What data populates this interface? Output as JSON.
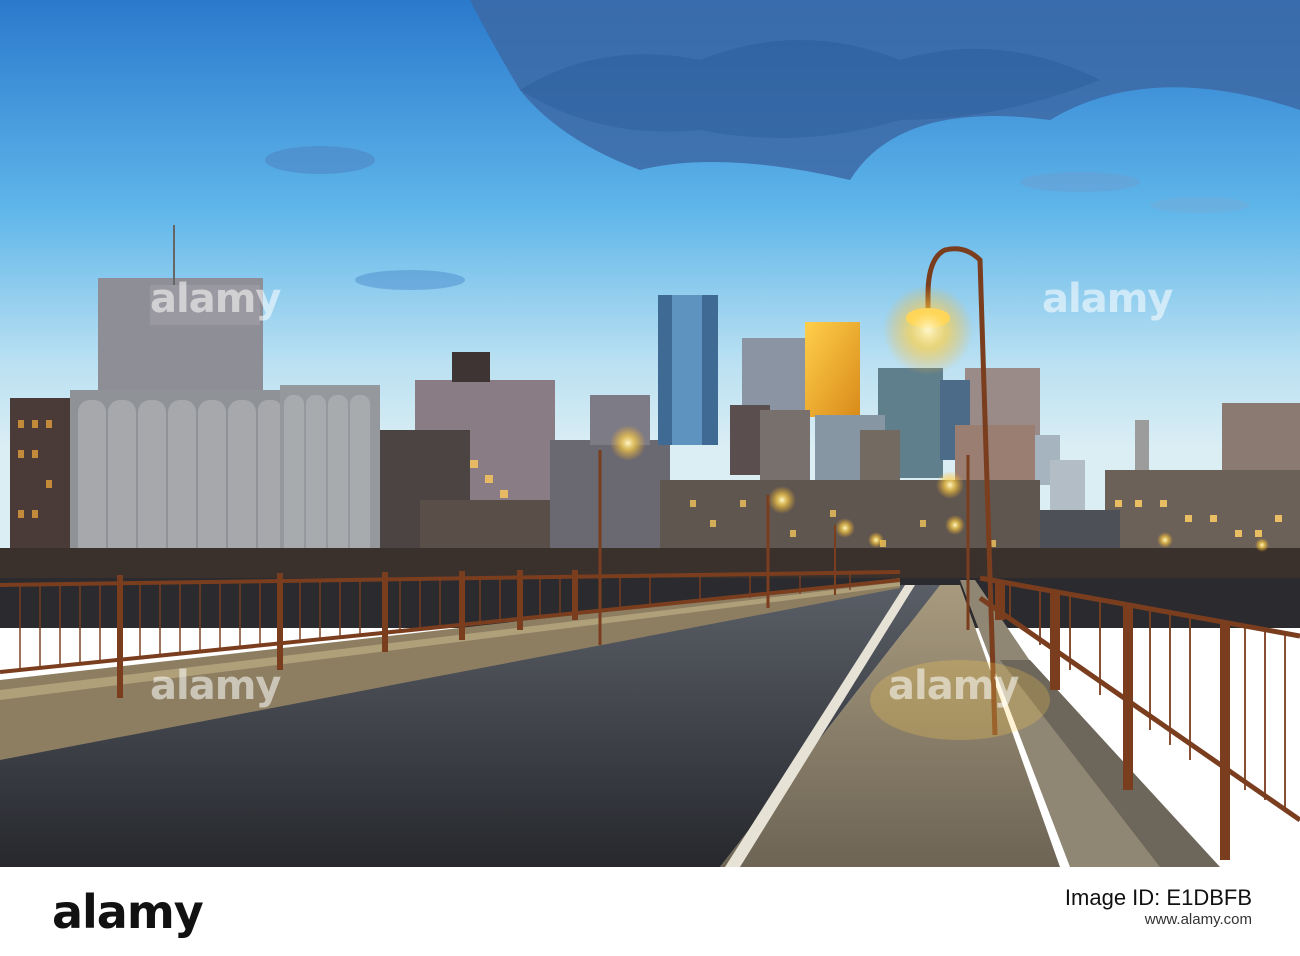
{
  "watermark": {
    "text": "alamy",
    "instances": [
      "alamy",
      "alamy",
      "alamy",
      "alamy"
    ]
  },
  "footer": {
    "logo": "alamy",
    "image_id_label": "Image ID: E1DBFB",
    "website": "www.alamy.com"
  },
  "colors": {
    "sky_top": "#2f7fd0",
    "sky_bottom": "#cfe6f3",
    "lamp_glow": "#ffd24a",
    "railing": "#7a3e1f"
  }
}
